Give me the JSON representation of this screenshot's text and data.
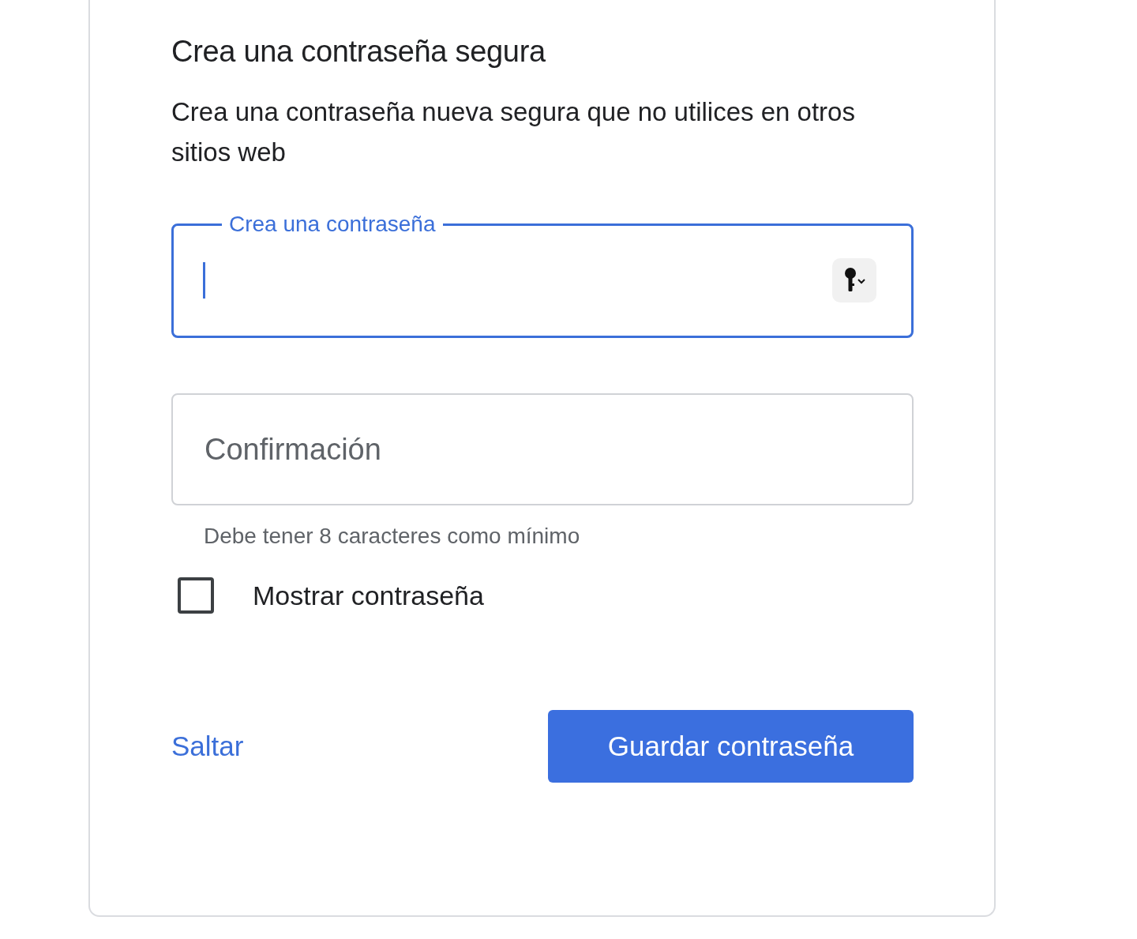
{
  "heading": "Crea una contraseña segura",
  "description": "Crea una contraseña nueva segura que no utilices en otros sitios web",
  "password_field": {
    "label": "Crea una contraseña",
    "focused": true
  },
  "confirm_field": {
    "placeholder": "Confirmación"
  },
  "hint": "Debe tener 8 caracteres como mínimo",
  "show_password": {
    "label": "Mostrar contraseña",
    "checked": false
  },
  "skip_link": "Saltar",
  "save_button": "Guardar contraseña"
}
